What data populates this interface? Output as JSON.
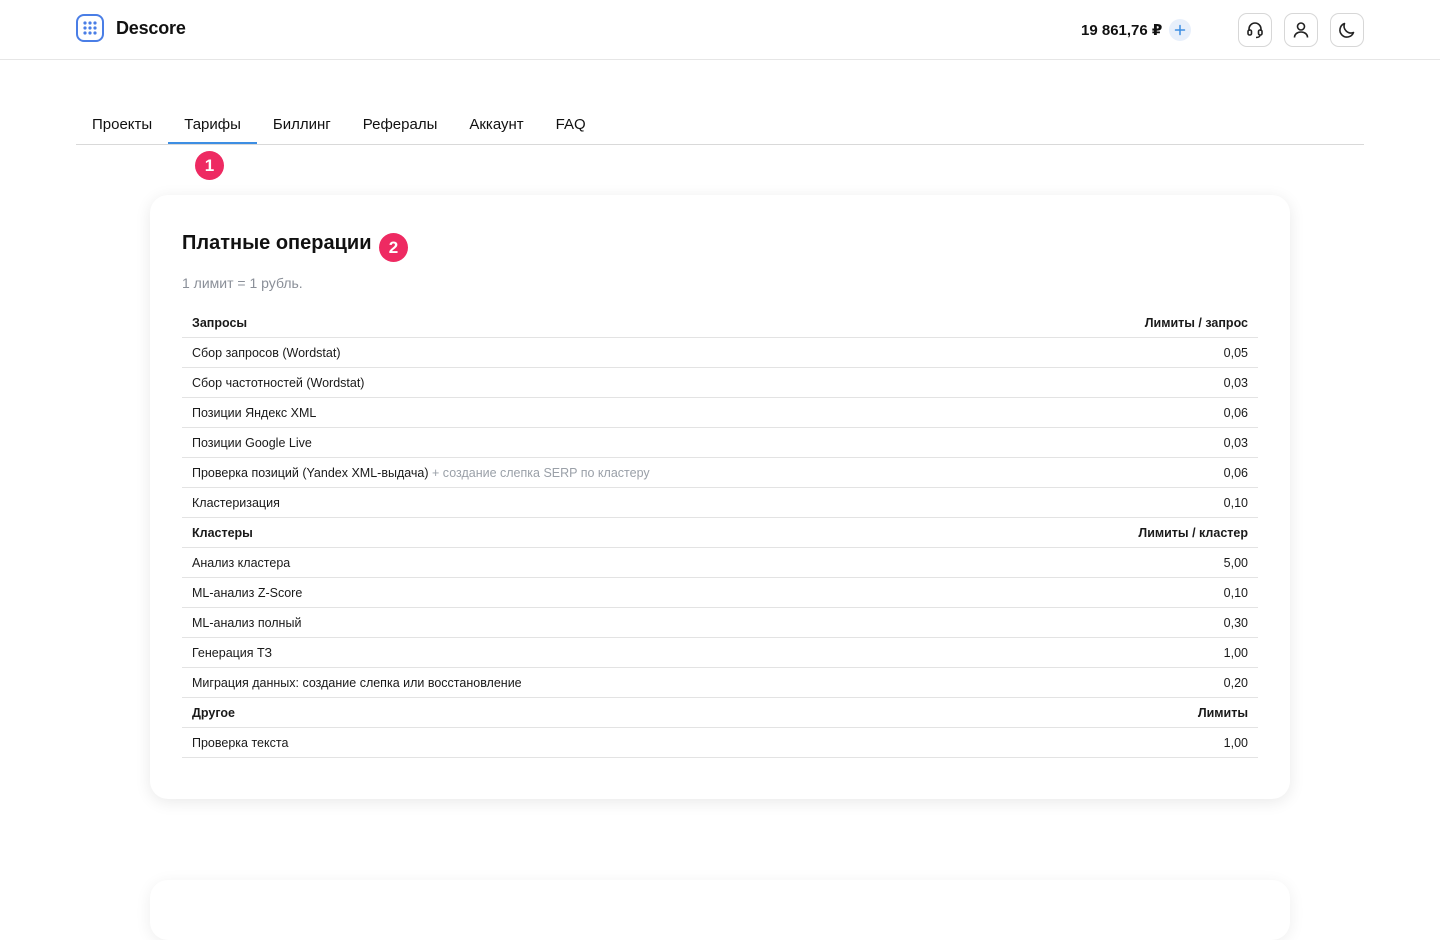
{
  "app": {
    "name": "Descore"
  },
  "header": {
    "balance": "19 861,76 ₽",
    "icons": [
      "support-headset-icon",
      "user-icon",
      "moon-icon"
    ]
  },
  "tabs": [
    {
      "label": "Проекты"
    },
    {
      "label": "Тарифы",
      "active": true
    },
    {
      "label": "Биллинг"
    },
    {
      "label": "Рефералы"
    },
    {
      "label": "Аккаунт"
    },
    {
      "label": "FAQ"
    }
  ],
  "markers": [
    "1",
    "2"
  ],
  "card": {
    "title": "Платные операции",
    "subtitle": "1 лимит = 1 рубль.",
    "sections": [
      {
        "name": "Запросы",
        "unit": "Лимиты / запрос",
        "rows": [
          {
            "label": "Сбор запросов (Wordstat)",
            "note": "",
            "value": "0,05"
          },
          {
            "label": "Сбор частотностей (Wordstat)",
            "note": "",
            "value": "0,03"
          },
          {
            "label": "Позиции Яндекс XML",
            "note": "",
            "value": "0,06"
          },
          {
            "label": "Позиции Google Live",
            "note": "",
            "value": "0,03"
          },
          {
            "label": "Проверка позиций (Yandex XML-выдача)",
            "note": "+ создание слепка SERP по кластеру",
            "value": "0,06"
          },
          {
            "label": "Кластеризация",
            "note": "",
            "value": "0,10"
          }
        ]
      },
      {
        "name": "Кластеры",
        "unit": "Лимиты / кластер",
        "rows": [
          {
            "label": "Анализ кластера",
            "note": "",
            "value": "5,00"
          },
          {
            "label": "ML-анализ Z-Score",
            "note": "",
            "value": "0,10"
          },
          {
            "label": "ML-анализ полный",
            "note": "",
            "value": "0,30"
          },
          {
            "label": "Генерация ТЗ",
            "note": "",
            "value": "1,00"
          },
          {
            "label": "Миграция данных: создание слепка или восстановление",
            "note": "",
            "value": "0,20"
          }
        ]
      },
      {
        "name": "Другое",
        "unit": "Лимиты",
        "rows": [
          {
            "label": "Проверка текста",
            "note": "",
            "value": "1,00"
          }
        ]
      }
    ]
  },
  "colors": {
    "accent": "#3d8ee3",
    "marker": "#ee2a62",
    "logo": "#4a7ee6"
  }
}
